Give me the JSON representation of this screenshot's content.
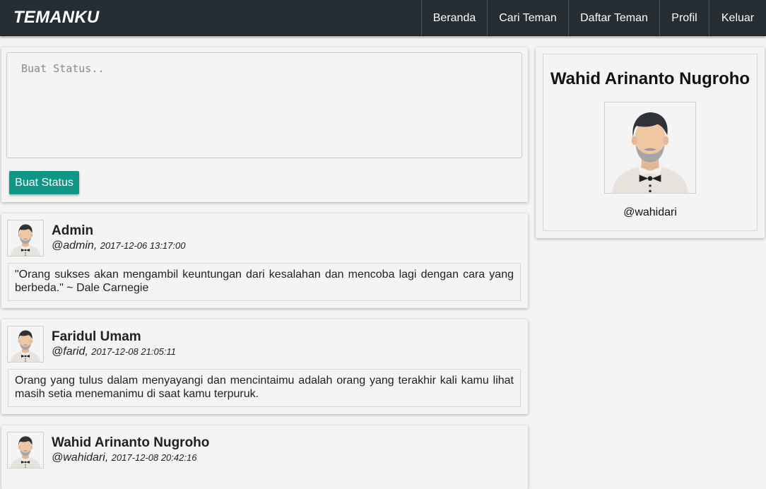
{
  "brand": "TEMANKU",
  "nav": {
    "items": [
      {
        "label": "Beranda"
      },
      {
        "label": "Cari Teman"
      },
      {
        "label": "Daftar Teman"
      },
      {
        "label": "Profil"
      },
      {
        "label": "Keluar"
      }
    ]
  },
  "composer": {
    "placeholder": "Buat Status..",
    "value": "",
    "button_label": "Buat Status"
  },
  "posts": [
    {
      "name": "Admin",
      "handle": "@admin",
      "date": "2017-12-06 13:17:00",
      "body": "\"Orang sukses akan mengambil keuntungan dari kesalahan dan mencoba lagi dengan cara yang berbeda.\" ~ Dale Carnegie"
    },
    {
      "name": "Faridul Umam",
      "handle": "@farid",
      "date": "2017-12-08 21:05:11",
      "body": "Orang yang tulus dalam menyayangi dan mencintaimu adalah orang yang terakhir kali kamu lihat masih setia menemanimu di saat kamu terpuruk."
    },
    {
      "name": "Wahid Arinanto Nugroho",
      "handle": "@wahidari",
      "date": "2017-12-08 20:42:16",
      "body": ""
    }
  ],
  "profile": {
    "name": "Wahid Arinanto Nugroho",
    "handle": "@wahidari",
    "avatar_icon": "man-avatar-icon"
  },
  "colors": {
    "navbar": "#262e33",
    "accent": "#0e9785",
    "background": "#f4f4f4"
  }
}
